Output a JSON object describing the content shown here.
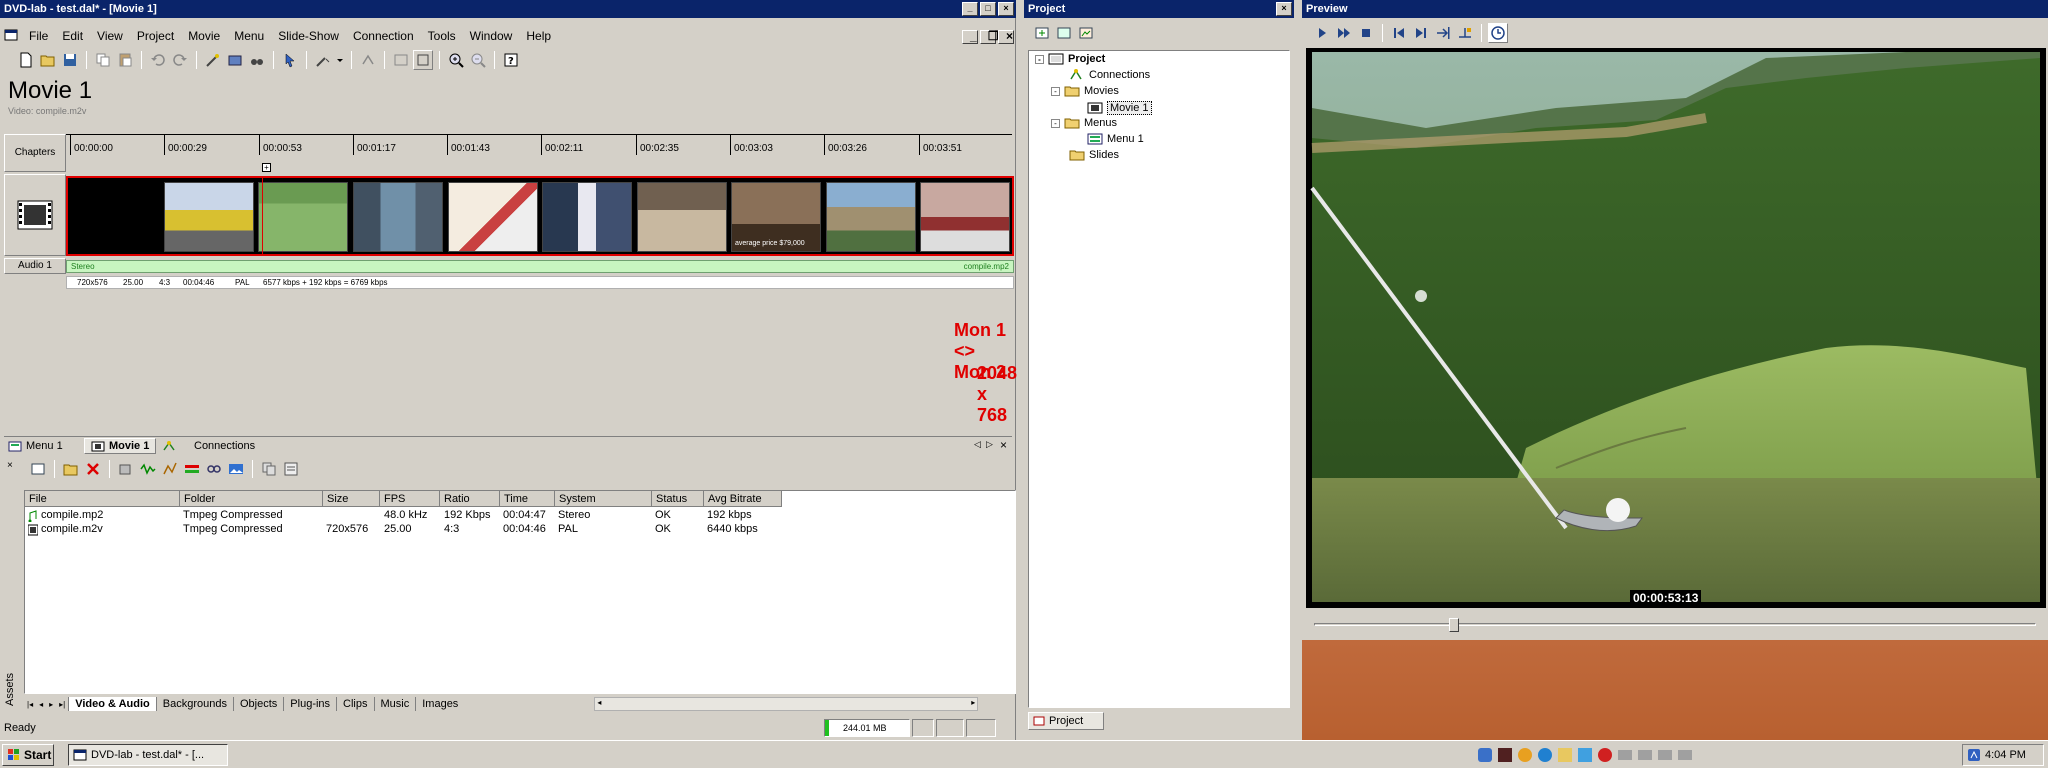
{
  "main_window": {
    "title": "DVD-lab - test.dal* - [Movie 1]",
    "menu": [
      "File",
      "Edit",
      "View",
      "Project",
      "Movie",
      "Menu",
      "Slide-Show",
      "Connection",
      "Tools",
      "Window",
      "Help"
    ],
    "movie_title": "Movie 1",
    "movie_subtitle": "Video: compile.m2v",
    "chapters_label": "Chapters",
    "audio_label": "Audio 1",
    "timecodes": [
      "00:00:00",
      "00:00:29",
      "00:00:53",
      "00:01:17",
      "00:01:43",
      "00:02:11",
      "00:02:35",
      "00:03:03",
      "00:03:26",
      "00:03:51"
    ],
    "audio_left": "Stereo",
    "audio_right": "compile.mp2",
    "info_line": [
      "720x576",
      "25.00",
      "4:3",
      "00:04:46",
      "PAL",
      "6577 kbps + 192 kbps = 6769 kbps"
    ],
    "thumb_caption": "average price $79,000",
    "monitor_note": "Mon 1 <> Mon 2",
    "resolution_note": "2048 x 768"
  },
  "doc_tabs": [
    "Menu 1",
    "Movie 1",
    "Connections"
  ],
  "assets": {
    "side_label": "Assets",
    "columns": [
      "File",
      "Folder",
      "Size",
      "FPS",
      "Ratio",
      "Time",
      "System",
      "Status",
      "Avg Bitrate"
    ],
    "rows": [
      [
        "compile.mp2",
        "Tmpeg Compressed",
        "",
        "48.0 kHz",
        "192 Kbps",
        "00:04:47",
        "Stereo",
        "OK",
        "192 kbps"
      ],
      [
        "compile.m2v",
        "Tmpeg Compressed",
        "720x576",
        "25.00",
        "4:3",
        "00:04:46",
        "PAL",
        "OK",
        "6440 kbps"
      ]
    ],
    "bottom_tabs": [
      "Video & Audio",
      "Backgrounds",
      "Objects",
      "Plug-ins",
      "Clips",
      "Music",
      "Images"
    ]
  },
  "status": {
    "text": "Ready",
    "memory": "244.01 MB"
  },
  "project_panel": {
    "title": "Project",
    "tree": [
      {
        "label": "Project",
        "level": 0
      },
      {
        "label": "Connections",
        "level": 1
      },
      {
        "label": "Movies",
        "level": 1
      },
      {
        "label": "Movie 1",
        "level": 2
      },
      {
        "label": "Menus",
        "level": 1
      },
      {
        "label": "Menu 1",
        "level": 2
      },
      {
        "label": "Slides",
        "level": 1
      }
    ],
    "tab": "Project"
  },
  "preview_panel": {
    "title": "Preview",
    "timecode": "00:00:53:13",
    "slider_position": 0.19
  },
  "taskbar": {
    "start": "Start",
    "task": "DVD-lab - test.dal* - [...",
    "clock": "4:04 PM"
  },
  "colors": {
    "titlebar": "#0a246a",
    "window_bg": "#d4d0c8",
    "audio_track": "#c8f5c0",
    "video_track_border": "#e00000",
    "annotation": "#e00000",
    "taskbar": "#d4d0c8"
  }
}
